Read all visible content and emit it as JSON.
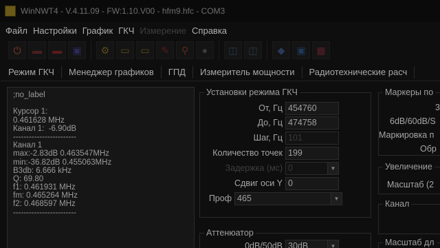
{
  "window": {
    "title": "WinNWT4 - V.4.11.09 - FW:1.10.V00 - hfm9.hfc - COM3"
  },
  "menu": [
    "Файл",
    "Настройки",
    "График",
    "ГКЧ",
    "Измерение",
    "Справка"
  ],
  "toolbar": {
    "buttons": [
      {
        "name": "power-icon",
        "glyph": "⏻",
        "color": "#7a3a2a"
      },
      {
        "name": "sweep-icon",
        "glyph": "▬",
        "color": "#4a1e1e"
      },
      {
        "name": "single-sweep-icon",
        "glyph": "▬",
        "color": "#5a1a1a"
      },
      {
        "name": "stop-icon",
        "glyph": "▣",
        "color": "#2a2a5a"
      },
      {
        "name": "settings-icon",
        "glyph": "⚙",
        "color": "#5a4a1a"
      },
      {
        "name": "folder-open-icon",
        "glyph": "▭",
        "color": "#5a4a1a"
      },
      {
        "name": "folder-icon",
        "glyph": "▭",
        "color": "#5a4a1a"
      },
      {
        "name": "pencil-icon",
        "glyph": "✎",
        "color": "#5a1a1a"
      },
      {
        "name": "probe-icon",
        "glyph": "⚲",
        "color": "#5a2a1a"
      },
      {
        "name": "linux-icon",
        "glyph": "●",
        "color": "#3a3a3a"
      },
      {
        "name": "calibrate-icon",
        "glyph": "◫",
        "color": "#2a3a4a"
      },
      {
        "name": "calibrate-2-icon",
        "glyph": "◫",
        "color": "#2a3a4a"
      },
      {
        "name": "eraser-icon",
        "glyph": "◆",
        "color": "#2a3a5a"
      },
      {
        "name": "save-icon",
        "glyph": "▣",
        "color": "#1e3a5a"
      },
      {
        "name": "grid-icon",
        "glyph": "▦",
        "color": "#5a1e2a"
      }
    ]
  },
  "tabs": [
    "Режим ГКЧ",
    "Менеджер графиков",
    "ГПД",
    "Измеритель мощности",
    "Радиотехнические расч"
  ],
  "left_panel": {
    "lines": [
      ";no_label",
      "",
      "Курсор 1:",
      "0.461628 MHz",
      "Канал 1:  -6.90dB",
      "------------------------",
      "Канал 1",
      "max:-2.83dB 0.463547MHz",
      "min:-36.82dB 0.455063MHz",
      "B3db: 6.666 kHz",
      "Q: 69.80",
      "f1: 0.461931 MHz",
      "fm: 0.465264 MHz",
      "f2: 0.468597 MHz",
      "------------------------"
    ]
  },
  "sweep_settings": {
    "title": "Установки режима ГКЧ",
    "from_label": "От, Гц",
    "from_value": "454760",
    "to_label": "До, Гц",
    "to_value": "474758",
    "step_label": "Шаг, Гц",
    "step_value": "101",
    "points_label": "Количество точек",
    "points_value": "199",
    "delay_label": "Задержка (мс)",
    "delay_value": "0",
    "shift_label": "Сдвиг оси Y",
    "shift_value": "0",
    "profile_label": "Проф",
    "profile_value": "465"
  },
  "attenuator": {
    "title": "Аттенюатор",
    "label": "0dB/50dB",
    "value": "30dB"
  },
  "markers": {
    "title": "Маркеры по",
    "line1": "3",
    "line2": "6dB/60dB/S",
    "line3": "Маркировка п",
    "line4": "Обр"
  },
  "zoom": {
    "title": "Увеличение",
    "label": "Масштаб (2"
  },
  "channel": {
    "title": "Канал"
  },
  "scale_bottom": {
    "title": "Масштаб дл"
  }
}
